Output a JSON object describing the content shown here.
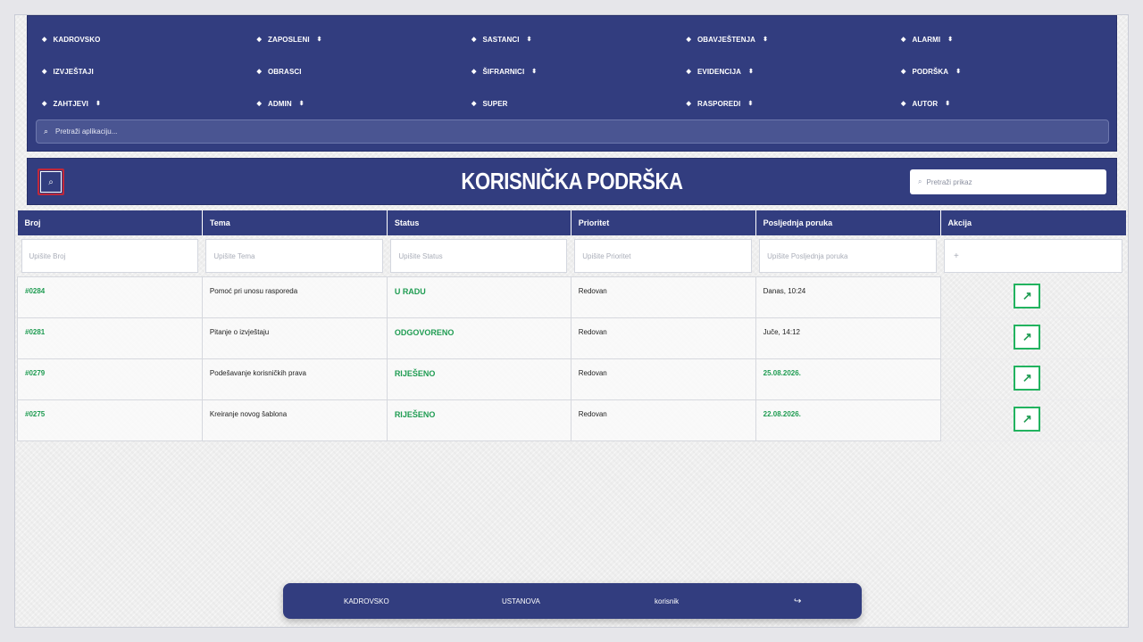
{
  "nav": {
    "items": [
      {
        "label": "KADROVSKO",
        "dropdown": false
      },
      {
        "label": "ZAPOSLENI",
        "dropdown": true
      },
      {
        "label": "SASTANCI",
        "dropdown": true
      },
      {
        "label": "OBAVJEŠTENJA",
        "dropdown": true
      },
      {
        "label": "ALARMI",
        "dropdown": true
      },
      {
        "label": "IZVJEŠTAJI",
        "dropdown": false
      },
      {
        "label": "OBRASCI",
        "dropdown": false
      },
      {
        "label": "ŠIFRARNICI",
        "dropdown": true
      },
      {
        "label": "EVIDENCIJA",
        "dropdown": true
      },
      {
        "label": "PODRŠKA",
        "dropdown": true
      },
      {
        "label": "ZAHTJEVI",
        "dropdown": true
      },
      {
        "label": "ADMIN",
        "dropdown": true
      },
      {
        "label": "SUPER",
        "dropdown": false
      },
      {
        "label": "RASPOREDI",
        "dropdown": true
      },
      {
        "label": "AUTOR",
        "dropdown": true
      }
    ],
    "bullet_glyph": "◆",
    "dropdown_glyph": "⬍",
    "search": {
      "placeholder": "Pretraži aplikaciju...",
      "icon": "search-icon",
      "glyph": "⌕"
    }
  },
  "header": {
    "title": "KORISNIČKA PODRŠKA",
    "search_toggle_glyph": "⌕",
    "view_search": {
      "placeholder": "Pretraži prikaz",
      "glyph": "⌕"
    }
  },
  "table": {
    "columns": [
      "Broj",
      "Tema",
      "Status",
      "Prioritet",
      "Posljednja poruka",
      "Akcija"
    ],
    "filters": [
      "Upišite Broj",
      "Upišite Tema",
      "Upišite Status",
      "Upišite Prioritet",
      "Upišite Posljednja poruka"
    ],
    "filter_add_glyph": "+",
    "action_glyph": "↗",
    "rows": [
      {
        "broj": "#0284",
        "tema": "Pomoć pri unosu rasporeda",
        "status": "U RADU",
        "prioritet": "Redovan",
        "poruka": "Danas, 10:24",
        "poruka_highlight": false
      },
      {
        "broj": "#0281",
        "tema": "Pitanje o izvještaju",
        "status": "ODGOVORENO",
        "prioritet": "Redovan",
        "poruka": "Juče, 14:12",
        "poruka_highlight": false
      },
      {
        "broj": "#0279",
        "tema": "Podešavanje korisničkih prava",
        "status": "RIJEŠENO",
        "prioritet": "Redovan",
        "poruka": "25.08.2026.",
        "poruka_highlight": true
      },
      {
        "broj": "#0275",
        "tema": "Kreiranje novog šablona",
        "status": "RIJEŠENO",
        "prioritet": "Redovan",
        "poruka": "22.08.2026.",
        "poruka_highlight": true
      }
    ]
  },
  "footer": {
    "module": "KADROVSKO",
    "institution": "USTANOVA",
    "user": "korisnik",
    "logout_glyph": "↪"
  },
  "colors": {
    "primary": "#323d7f",
    "accent_green": "#1f9c52",
    "toggle_border": "#c0283a"
  }
}
